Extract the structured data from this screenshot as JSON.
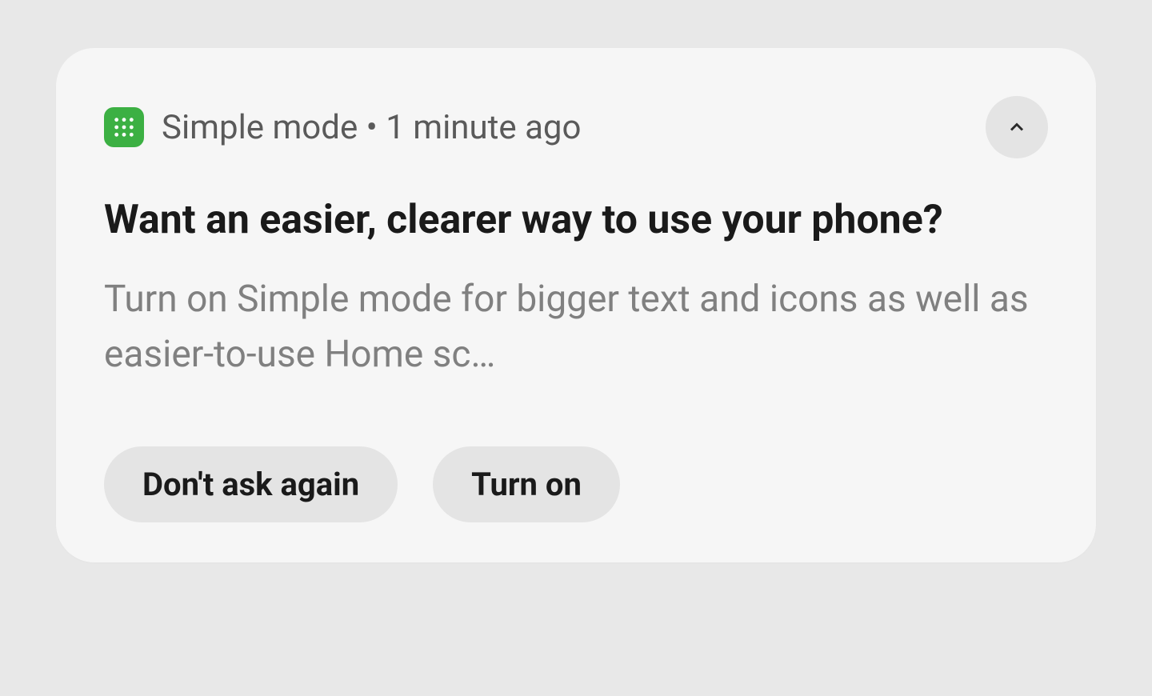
{
  "notification": {
    "app_name": "Simple mode",
    "separator": " • ",
    "timestamp": "1 minute ago",
    "title": "Want an easier, clearer way to use your phone?",
    "body": "Turn on Simple mode for bigger text and icons as well as easier-to-use Home sc…",
    "actions": {
      "dismiss": "Don't ask again",
      "confirm": "Turn on"
    },
    "icon_name": "apps-grid-icon",
    "colors": {
      "app_icon_bg": "#3cb043",
      "card_bg": "#f6f6f6",
      "button_bg": "#e4e4e4"
    }
  }
}
